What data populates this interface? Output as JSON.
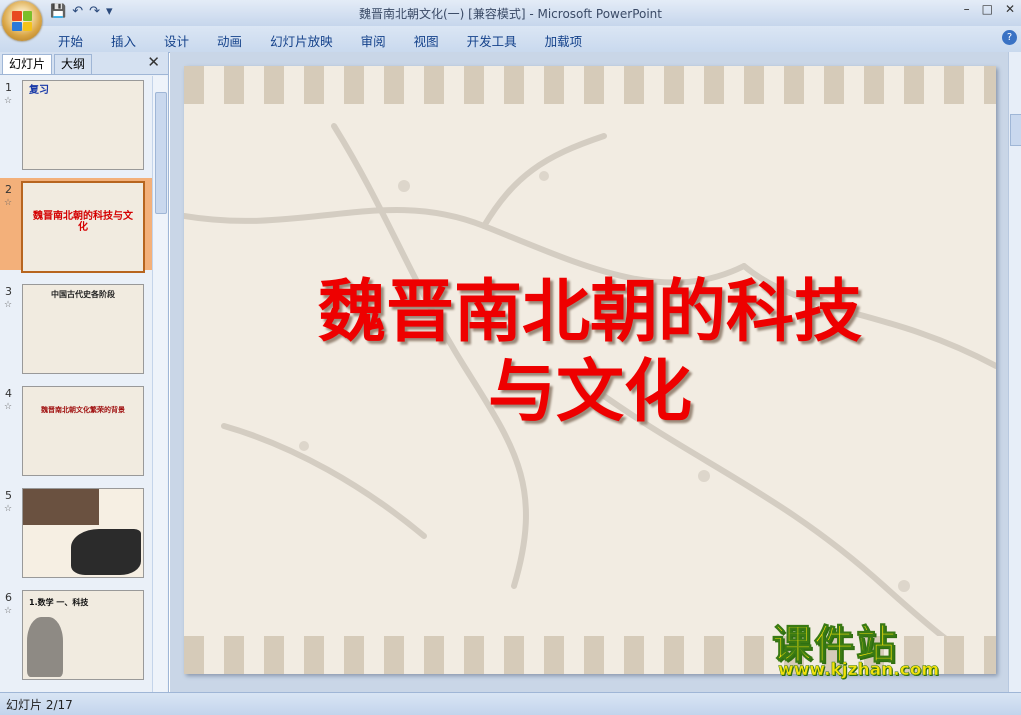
{
  "window": {
    "title": "魏晋南北朝文化(一) [兼容模式] - Microsoft PowerPoint",
    "minimize": "–",
    "maximize": "□",
    "close": "✕"
  },
  "ribbon": {
    "tabs": [
      "开始",
      "插入",
      "设计",
      "动画",
      "幻灯片放映",
      "审阅",
      "视图",
      "开发工具",
      "加载项"
    ],
    "help": "?"
  },
  "pane": {
    "tab_slides": "幻灯片",
    "tab_outline": "大纲",
    "close": "✕"
  },
  "thumbnails": [
    {
      "num": "1",
      "title": "复习"
    },
    {
      "num": "2",
      "title": "魏晋南北朝的科技与文化"
    },
    {
      "num": "3",
      "title": "中国古代史各阶段"
    },
    {
      "num": "4",
      "title": "魏晋南北朝文化繁荣的背景"
    },
    {
      "num": "5",
      "title": ""
    },
    {
      "num": "6",
      "title": "1.数学 一、科技"
    }
  ],
  "slide": {
    "title_line1": "魏晋南北朝的科技",
    "title_line2": "与文化"
  },
  "watermark": {
    "cn": "课件站",
    "url": "www.kjzhan.com"
  },
  "status": {
    "slide_counter": "幻灯片 2/17"
  },
  "colors": {
    "title_red": "#ee0000",
    "ribbon_blue": "#15428b",
    "selected_thumb": "#f3b07a"
  }
}
